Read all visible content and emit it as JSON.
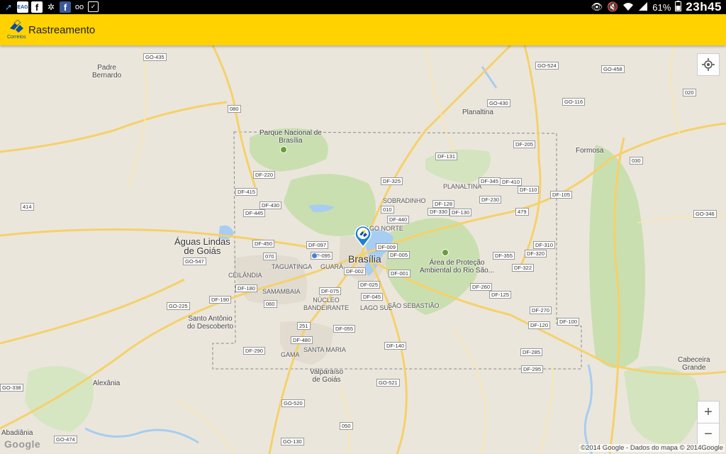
{
  "status_bar": {
    "left_icons": [
      "arrow-icon",
      "eag-icon",
      "facebook-icon",
      "settings-icon",
      "facebook-icon",
      "voicemail-icon",
      "clipboard-icon"
    ],
    "eag_label": "EAG",
    "battery": "61%",
    "clock": "23h45"
  },
  "app_bar": {
    "logo_label": "Correios",
    "title": "Rastreamento"
  },
  "map": {
    "places": {
      "padre_bernardo": "Padre\nBernardo",
      "planaltina": "Planaltina",
      "parque": "Parque Nacional de\nBrasília",
      "formosa": "Formosa",
      "planaltina_df": "PLANALTINA",
      "sobradinho": "SOBRADINHO",
      "lago_norte": "LAGO NORTE",
      "aguas_lindas": "Águas Lindas\nde Goiás",
      "brasilia": "Brasília",
      "taguatinga": "TAGUATINGA",
      "guara": "GUARÁ",
      "ceilandia": "CEILÂNDIA",
      "samambaia": "SAMAMBAIA",
      "nucleo": "NÚCLEO\nBANDEIRANTE",
      "lago_sul": "LAGO SUL",
      "sao_sebastiao": "SÃO SEBASTIÃO",
      "area_protecao": "Área de Proteção\nAmbiental do Rio São...",
      "santo_antonio": "Santo Antônio\ndo Descoberto",
      "gama": "GAMA",
      "santa_maria": "SANTA MARIA",
      "valparaiso": "Valparaíso\nde Goiás",
      "alexania": "Alexânia",
      "cabeceira": "Cabeceira\nGrande",
      "abadiania": "Abadiânia"
    },
    "roads": {
      "go435": "GO-435",
      "go524": "GO-524",
      "go458": "GO-458",
      "r020": "020",
      "r080": "080",
      "go430": "GO-430",
      "go116": "GO-116",
      "df205": "DF-205",
      "df131": "DF-131",
      "r030": "030",
      "df220": "DF-220",
      "df325": "DF-325",
      "df345": "DF-345",
      "df410": "DF-410",
      "df110": "DF-110",
      "df105": "DF-105",
      "df415": "DF-415",
      "df230": "DF-230",
      "r414": "414",
      "df430": "DF-430",
      "df128": "DF-128",
      "r010": "010",
      "df330": "DF-330",
      "df130": "DF-130",
      "r479": "479",
      "go346": "GO-346",
      "df445": "DF-445",
      "df440": "DF-440",
      "df450": "DF-450",
      "df097": "DF-097",
      "df009": "DF-009",
      "df310": "DF-310",
      "r070": "070",
      "df095": "DF-095",
      "df005": "DF-005",
      "df355": "DF-355",
      "df320": "DF-320",
      "go547": "GO-547",
      "df002": "DF-002",
      "df001": "DF-001",
      "df322": "DF-322",
      "df180": "DF-180",
      "df075": "DF-075",
      "df025": "DF-025",
      "df260": "DF-260",
      "df190": "DF-190",
      "df045": "DF-045",
      "df125": "DF-125",
      "go225": "GO-225",
      "r060": "060",
      "df270": "DF-270",
      "df100": "DF-100",
      "r251": "251",
      "df120": "DF-120",
      "df055": "DF-055",
      "df480": "DF-480",
      "df140": "DF-140",
      "df290": "DF-290",
      "df285": "DF-285",
      "df295": "DF-295",
      "go338": "GO-338",
      "go521": "GO-521",
      "go520": "GO-520",
      "r050": "050",
      "go474": "GO-474",
      "go130": "GO-130"
    },
    "zoom_in": "+",
    "zoom_out": "−",
    "google_logo": "Google",
    "attribution": "©2014 Google - Dados do mapa © 2014Google"
  }
}
